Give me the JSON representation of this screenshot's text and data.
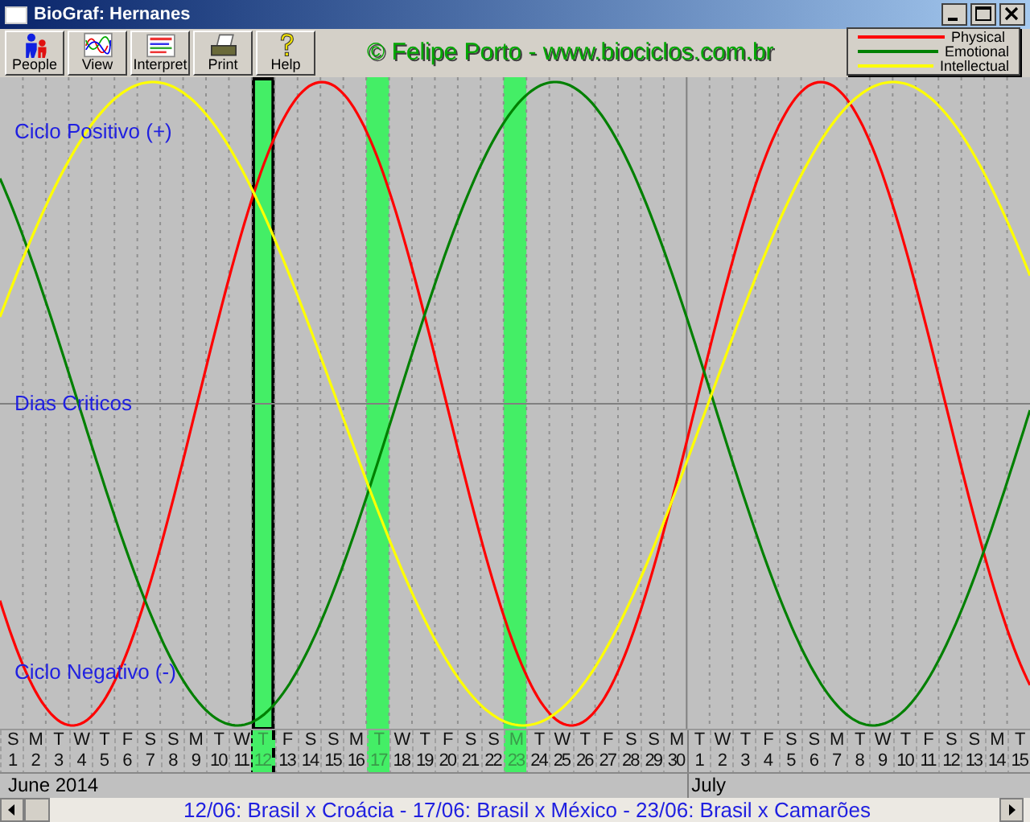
{
  "window": {
    "title": "BioGraf: Hernanes"
  },
  "toolbar": [
    {
      "label": "People",
      "kind": "people"
    },
    {
      "label": "View",
      "kind": "view"
    },
    {
      "label": "Interpret",
      "kind": "interpret"
    },
    {
      "label": "Print",
      "kind": "print"
    },
    {
      "label": "Help",
      "kind": "help"
    }
  ],
  "banner": "© Felipe Porto - www.biociclos.com.br",
  "legend": [
    {
      "label": "Physical",
      "color": "#ff0000"
    },
    {
      "label": "Emotional",
      "color": "#008000"
    },
    {
      "label": "Intellectual",
      "color": "#ffff00"
    }
  ],
  "chart_labels": {
    "positive": "Ciclo Positivo (+)",
    "critical": "Dias Criticos",
    "negative": "Ciclo Negativo (-)"
  },
  "days": [
    {
      "weekday": "S",
      "day": "1",
      "month": "June 2014",
      "highlighted": false,
      "selected": false
    },
    {
      "weekday": "M",
      "day": "2",
      "highlighted": false,
      "selected": false
    },
    {
      "weekday": "T",
      "day": "3",
      "highlighted": false,
      "selected": false
    },
    {
      "weekday": "W",
      "day": "4",
      "highlighted": false,
      "selected": false
    },
    {
      "weekday": "T",
      "day": "5",
      "highlighted": false,
      "selected": false
    },
    {
      "weekday": "F",
      "day": "6",
      "highlighted": false,
      "selected": false
    },
    {
      "weekday": "S",
      "day": "7",
      "highlighted": false,
      "selected": false
    },
    {
      "weekday": "S",
      "day": "8",
      "highlighted": false,
      "selected": false
    },
    {
      "weekday": "M",
      "day": "9",
      "highlighted": false,
      "selected": false
    },
    {
      "weekday": "T",
      "day": "10",
      "highlighted": false,
      "selected": false
    },
    {
      "weekday": "W",
      "day": "11",
      "highlighted": false,
      "selected": false
    },
    {
      "weekday": "T",
      "day": "12",
      "highlighted": true,
      "selected": true
    },
    {
      "weekday": "F",
      "day": "13",
      "highlighted": false,
      "selected": false
    },
    {
      "weekday": "S",
      "day": "14",
      "highlighted": false,
      "selected": false
    },
    {
      "weekday": "S",
      "day": "15",
      "highlighted": false,
      "selected": false
    },
    {
      "weekday": "M",
      "day": "16",
      "highlighted": false,
      "selected": false
    },
    {
      "weekday": "T",
      "day": "17",
      "highlighted": true,
      "selected": false
    },
    {
      "weekday": "W",
      "day": "18",
      "highlighted": false,
      "selected": false
    },
    {
      "weekday": "T",
      "day": "19",
      "highlighted": false,
      "selected": false
    },
    {
      "weekday": "F",
      "day": "20",
      "highlighted": false,
      "selected": false
    },
    {
      "weekday": "S",
      "day": "21",
      "highlighted": false,
      "selected": false
    },
    {
      "weekday": "S",
      "day": "22",
      "highlighted": false,
      "selected": false
    },
    {
      "weekday": "M",
      "day": "23",
      "highlighted": true,
      "selected": false
    },
    {
      "weekday": "T",
      "day": "24",
      "highlighted": false,
      "selected": false
    },
    {
      "weekday": "W",
      "day": "25",
      "highlighted": false,
      "selected": false
    },
    {
      "weekday": "T",
      "day": "26",
      "highlighted": false,
      "selected": false
    },
    {
      "weekday": "F",
      "day": "27",
      "highlighted": false,
      "selected": false
    },
    {
      "weekday": "S",
      "day": "28",
      "highlighted": false,
      "selected": false
    },
    {
      "weekday": "S",
      "day": "29",
      "highlighted": false,
      "selected": false
    },
    {
      "weekday": "M",
      "day": "30",
      "highlighted": false,
      "selected": false
    },
    {
      "weekday": "T",
      "day": "1",
      "month": "July",
      "highlighted": false,
      "selected": false
    },
    {
      "weekday": "W",
      "day": "2",
      "highlighted": false,
      "selected": false
    },
    {
      "weekday": "T",
      "day": "3",
      "highlighted": false,
      "selected": false
    },
    {
      "weekday": "F",
      "day": "4",
      "highlighted": false,
      "selected": false
    },
    {
      "weekday": "S",
      "day": "5",
      "highlighted": false,
      "selected": false
    },
    {
      "weekday": "S",
      "day": "6",
      "highlighted": false,
      "selected": false
    },
    {
      "weekday": "M",
      "day": "7",
      "highlighted": false,
      "selected": false
    },
    {
      "weekday": "T",
      "day": "8",
      "highlighted": false,
      "selected": false
    },
    {
      "weekday": "W",
      "day": "9",
      "highlighted": false,
      "selected": false
    },
    {
      "weekday": "T",
      "day": "10",
      "highlighted": false,
      "selected": false
    },
    {
      "weekday": "F",
      "day": "11",
      "highlighted": false,
      "selected": false
    },
    {
      "weekday": "S",
      "day": "12",
      "highlighted": false,
      "selected": false
    },
    {
      "weekday": "S",
      "day": "13",
      "highlighted": false,
      "selected": false
    },
    {
      "weekday": "M",
      "day": "14",
      "highlighted": false,
      "selected": false
    },
    {
      "weekday": "T",
      "day": "15",
      "highlighted": false,
      "selected": false
    }
  ],
  "status_bar": "12/06: Brasil x Croácia - 17/06: Brasil x México - 23/06: Brasil x Camarões"
}
